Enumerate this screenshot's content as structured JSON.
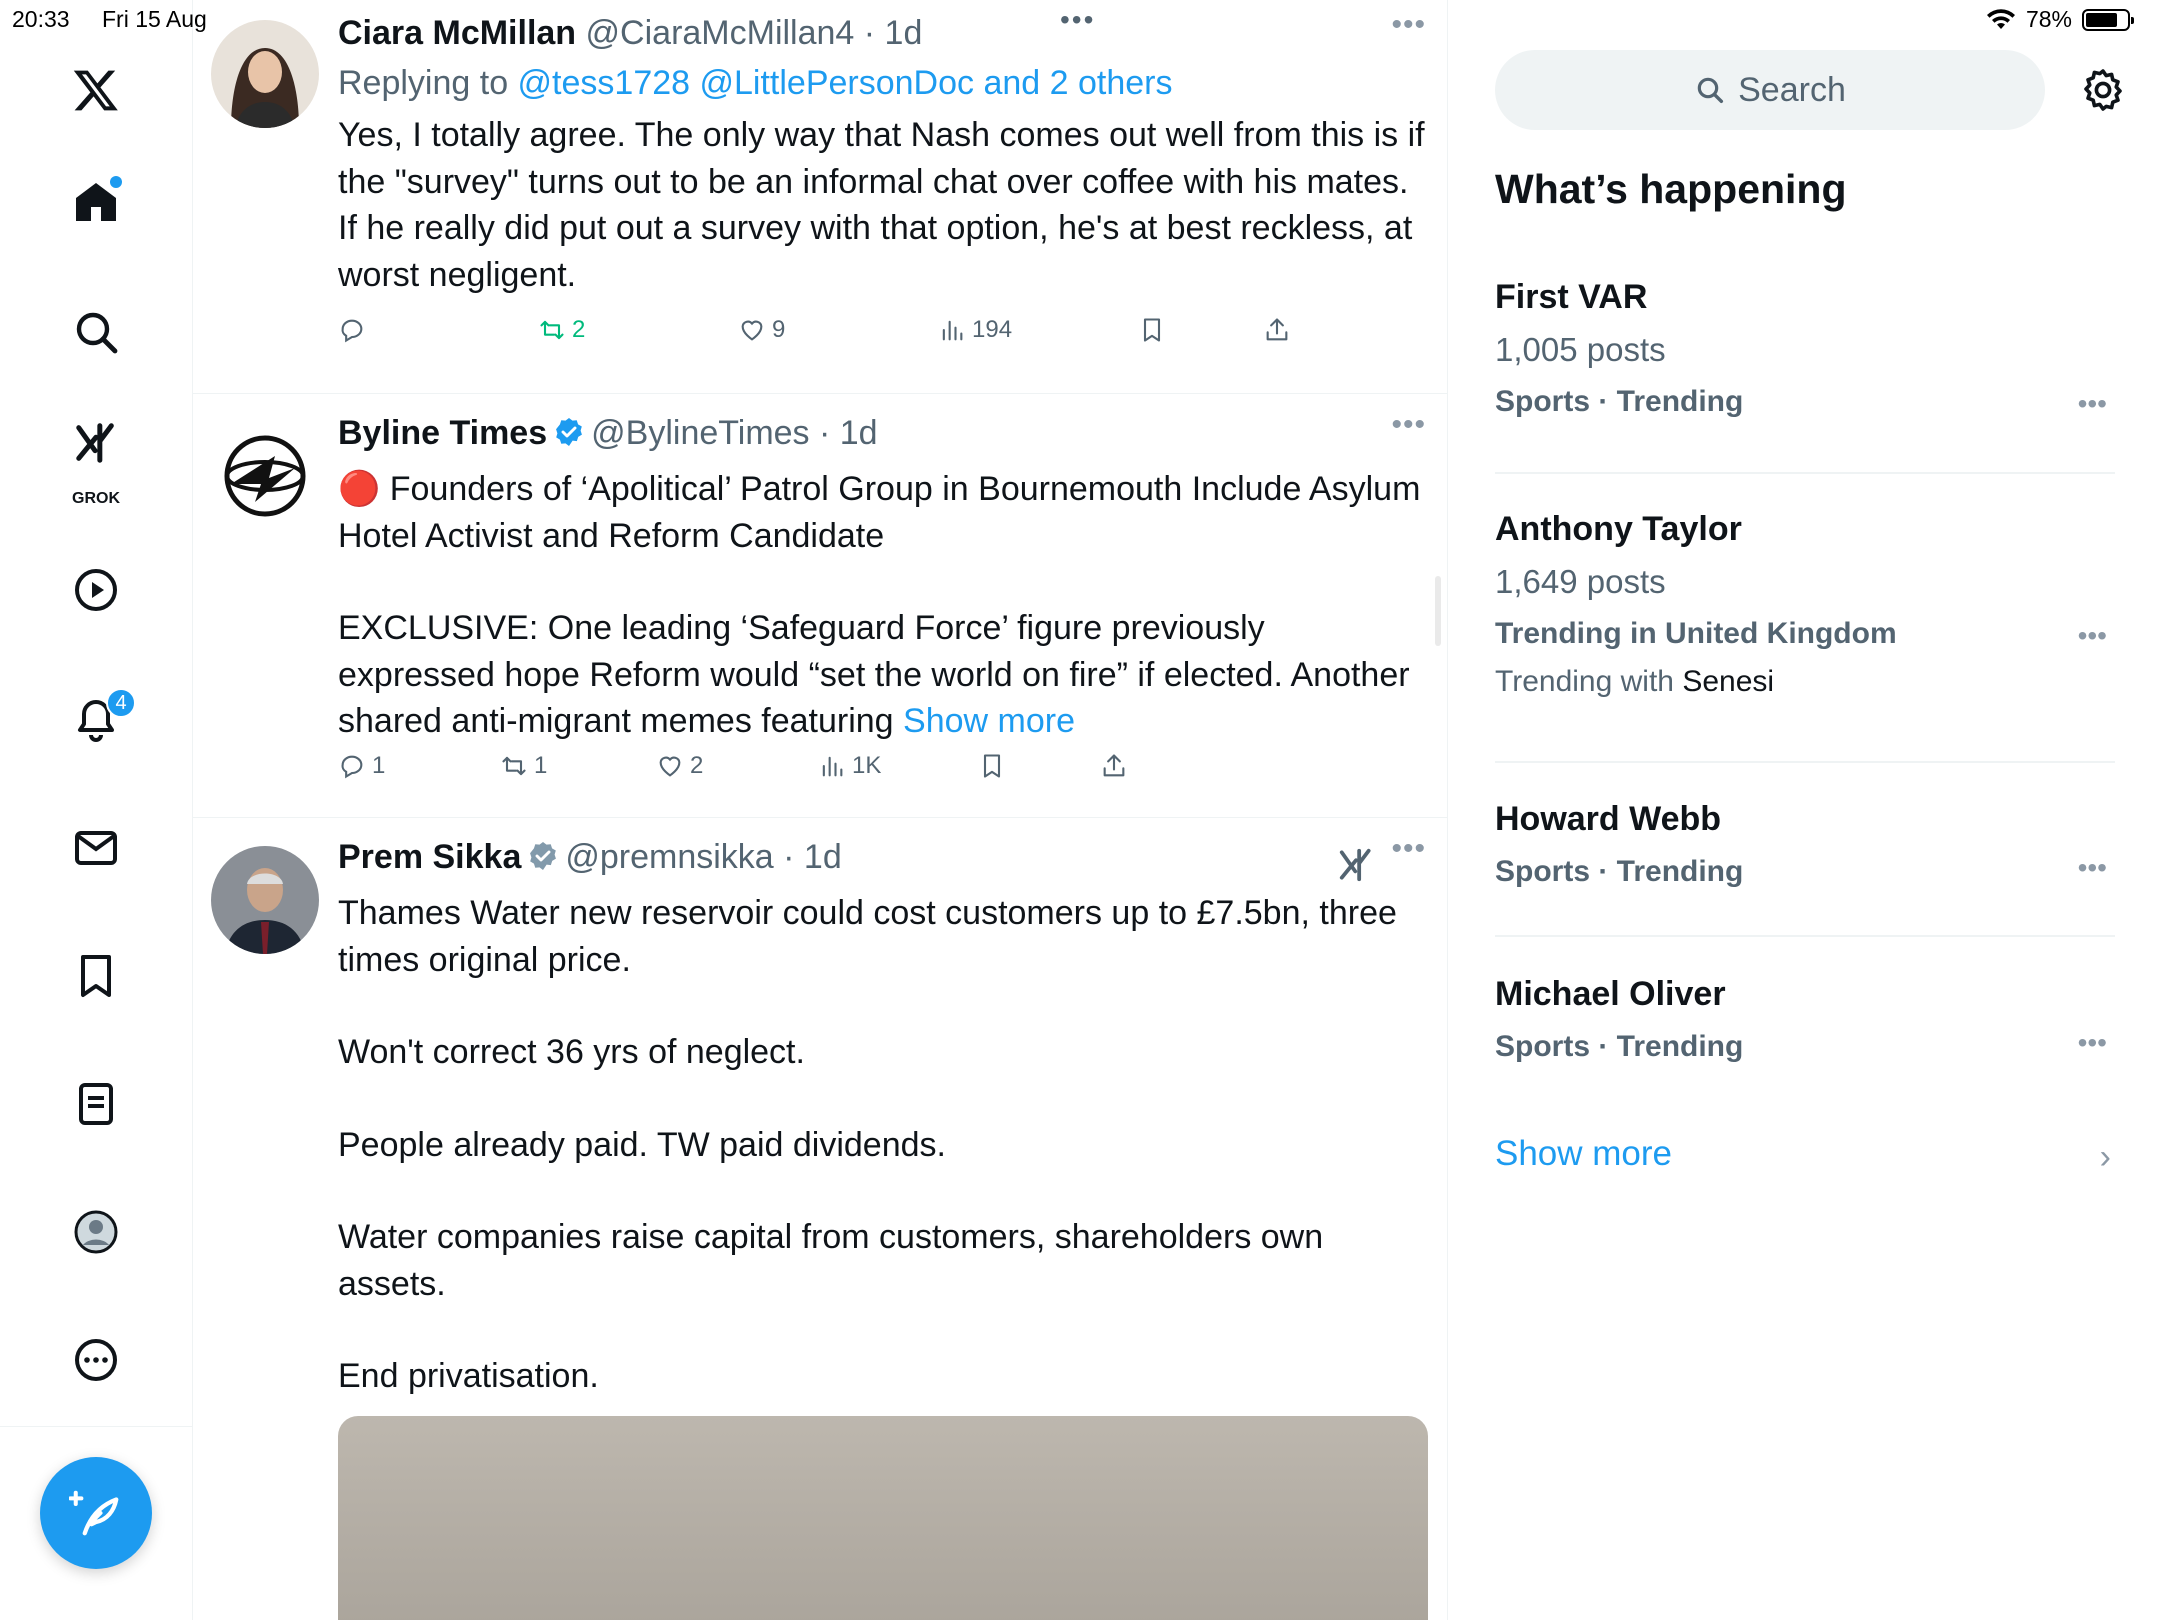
{
  "status": {
    "time": "20:33",
    "date": "Fri 15 Aug",
    "battery": "78%",
    "battery_level": 0.78
  },
  "nav": {
    "grok_label": "GROK",
    "notifications_badge": "4"
  },
  "tweets": [
    {
      "name": "Ciara McMillan",
      "meta": "@CiaraMcMillan4 · 1d",
      "replying_prefix": "Replying to ",
      "replying_users": "@tess1728 @LittlePersonDoc and 2 others",
      "text": "Yes, I totally agree. The only way that Nash comes out well from this is if the \"survey\" turns out to be an informal chat over coffee with his mates. If he really did put out a survey with that option, he's at best reckless, at worst negligent.",
      "replies": "",
      "reposts": "2",
      "likes": "9",
      "views": "194"
    },
    {
      "name": "Byline Times",
      "meta": "@BylineTimes · 1d",
      "text_1": "🔴 Founders of ‘Apolitical’ Patrol Group in Bournemouth Include Asylum Hotel Activist and Reform Candidate",
      "text_2": "EXCLUSIVE: One leading ‘Safeguard Force’ figure previously expressed hope Reform would “set the world on fire” if elected. Another shared anti-migrant memes featuring",
      "show_more": "Show more",
      "replies": "1",
      "reposts": "1",
      "likes": "2",
      "views": "1K"
    },
    {
      "name": "Prem Sikka",
      "meta": "@premnsikka · 1d",
      "lines": [
        "Thames Water new reservoir could cost customers up to £7.5bn, three times original price.",
        "Won't correct 36 yrs of neglect.",
        "People already paid. TW paid dividends.",
        "Water companies raise capital from customers, shareholders own assets.",
        "End privatisation."
      ]
    }
  ],
  "right": {
    "search_placeholder": "Search",
    "section_title": "What’s happening",
    "trends": [
      {
        "name": "First VAR",
        "posts": "1,005 posts",
        "category": "Sports · Trending",
        "with_prefix": "",
        "with_name": ""
      },
      {
        "name": "Anthony Taylor",
        "posts": "1,649 posts",
        "category": "Trending in United Kingdom",
        "with_prefix": "Trending with ",
        "with_name": "Senesi"
      },
      {
        "name": "Howard Webb",
        "posts": "",
        "category": "Sports · Trending",
        "with_prefix": "",
        "with_name": ""
      },
      {
        "name": "Michael Oliver",
        "posts": "",
        "category": "Sports · Trending",
        "with_prefix": "",
        "with_name": ""
      }
    ],
    "show_more": "Show more"
  },
  "colors": {
    "accent": "#1d9bf0",
    "repost_green": "#00ba7c",
    "secondary_text": "#536471"
  }
}
